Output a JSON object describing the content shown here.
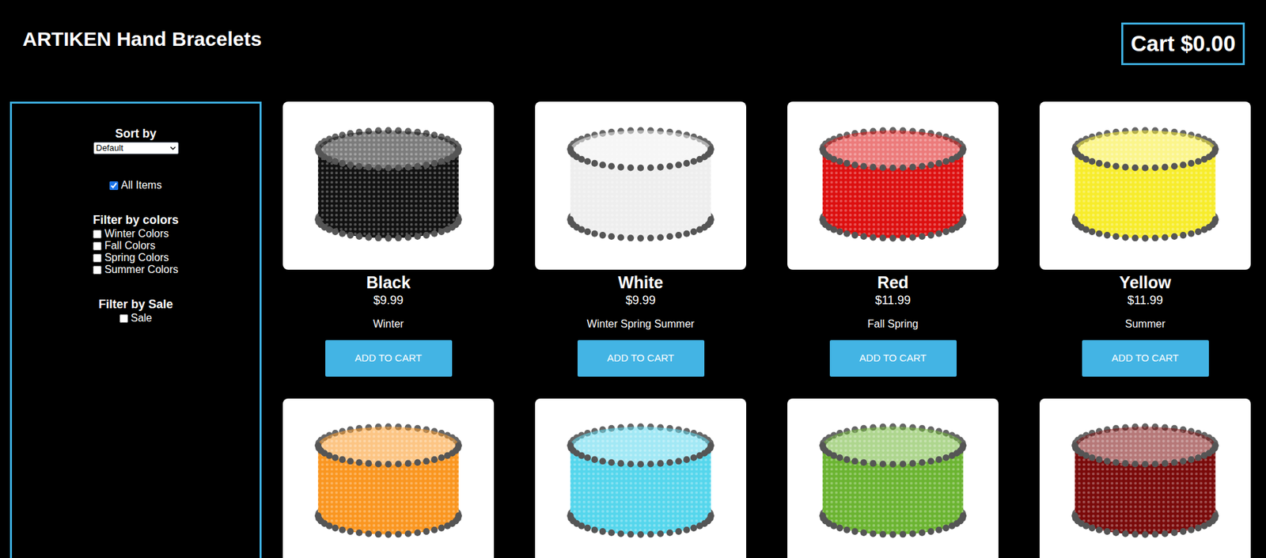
{
  "header": {
    "title": "ARTIKEN Hand Bracelets",
    "cart": "Cart $0.00"
  },
  "sidebar": {
    "sort_label": "Sort by",
    "sort_value": "Default",
    "all_items": {
      "label": "All Items",
      "checked": true
    },
    "color_filter": {
      "title": "Filter by colors",
      "options": [
        {
          "label": "Winter Colors",
          "checked": false
        },
        {
          "label": "Fall Colors",
          "checked": false
        },
        {
          "label": "Spring Colors",
          "checked": false
        },
        {
          "label": "Summer Colors",
          "checked": false
        }
      ]
    },
    "sale_filter": {
      "title": "Filter by Sale",
      "options": [
        {
          "label": "Sale",
          "checked": false
        }
      ]
    }
  },
  "products": [
    {
      "name": "Black",
      "price": "$9.99",
      "seasons": "Winter",
      "button": "ADD TO CART",
      "color": "#111111"
    },
    {
      "name": "White",
      "price": "$9.99",
      "seasons": "Winter Spring Summer",
      "button": "ADD TO CART",
      "color": "#eeeeee"
    },
    {
      "name": "Red",
      "price": "$11.99",
      "seasons": "Fall Spring",
      "button": "ADD TO CART",
      "color": "#dd0f0f"
    },
    {
      "name": "Yellow",
      "price": "$11.99",
      "seasons": "Summer",
      "button": "ADD TO CART",
      "color": "#f7ec2c"
    },
    {
      "color": "#fa9620"
    },
    {
      "color": "#55d6ec"
    },
    {
      "color": "#6bb431"
    },
    {
      "color": "#7a0a0a"
    }
  ]
}
